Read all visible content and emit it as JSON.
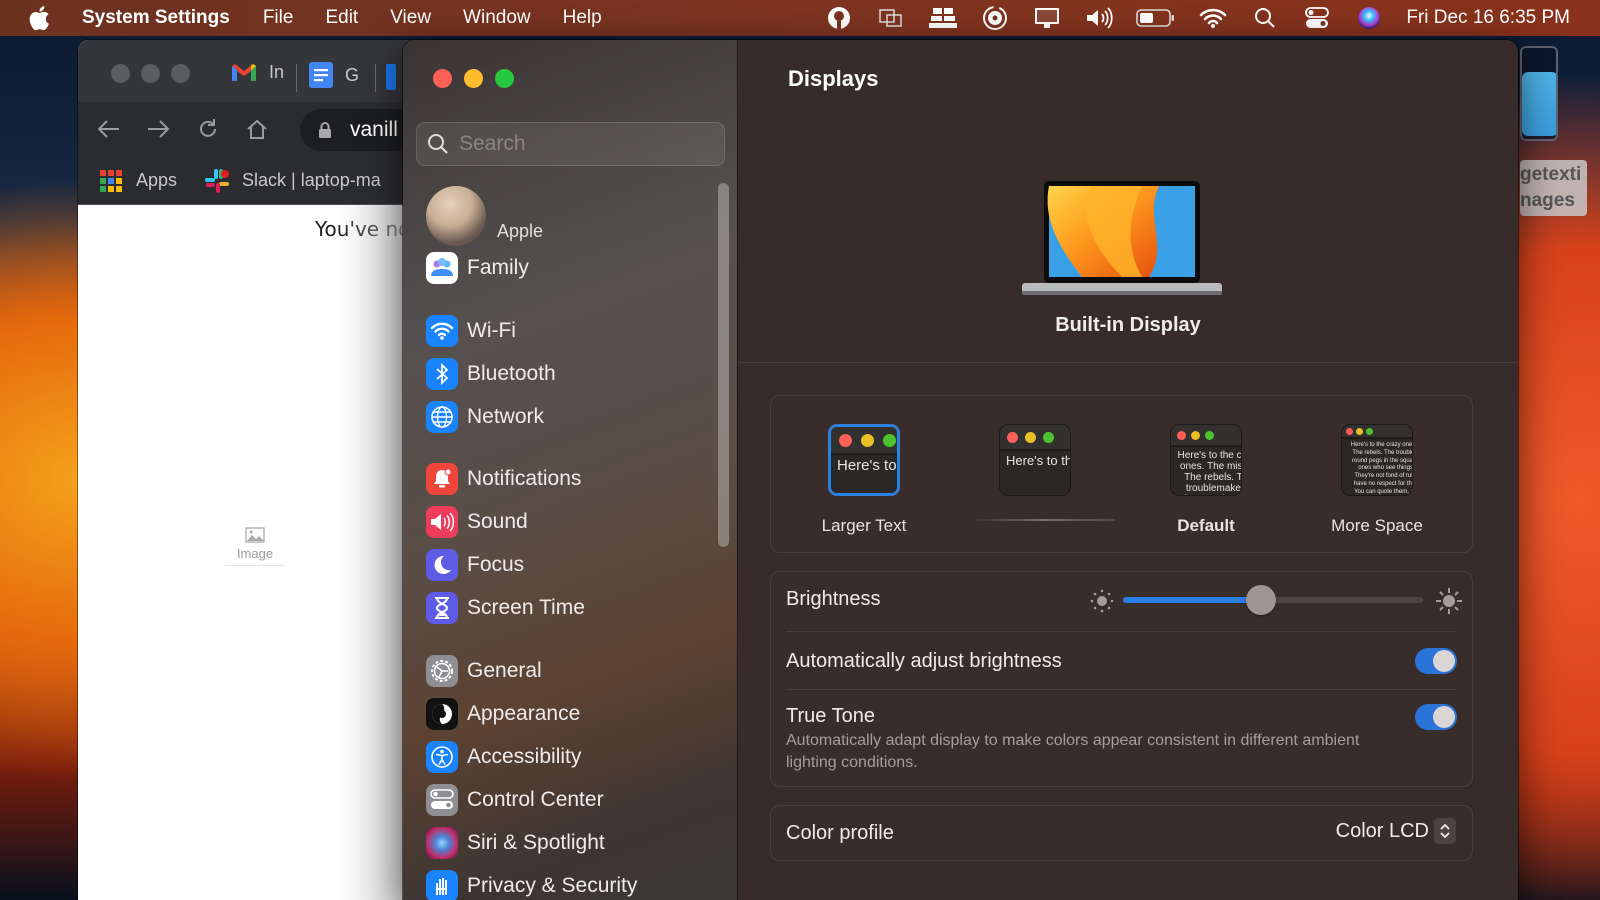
{
  "menubar": {
    "app_name": "System Settings",
    "menus": [
      "File",
      "Edit",
      "View",
      "Window",
      "Help"
    ],
    "status_icons": [
      "vpn-icon",
      "screen-mirroring-icon",
      "dropbox-icon",
      "time-machine-icon",
      "display-icon",
      "volume-icon",
      "battery-icon",
      "wifi-icon",
      "spotlight-search-icon",
      "control-center-icon",
      "siri-icon"
    ],
    "clock": "Fri Dec 16  6:35 PM"
  },
  "browser": {
    "tabs": [
      {
        "icon": "gmail-icon",
        "label": "In"
      },
      {
        "icon": "google-docs-icon",
        "label": "G"
      }
    ],
    "url": "vanill",
    "bookmarks": [
      {
        "icon": "apps-grid-icon",
        "label": "Apps"
      },
      {
        "icon": "slack-icon",
        "label": "Slack | laptop-ma"
      }
    ],
    "page_text": "You've no",
    "image_placeholder_label": "Image"
  },
  "settings": {
    "search": {
      "placeholder": "Search",
      "value": ""
    },
    "account_label": "Apple",
    "sidebar": [
      {
        "id": "family",
        "label": "Family",
        "icon": "family-icon",
        "color": "#ffffff"
      },
      {
        "id": "wifi",
        "label": "Wi-Fi",
        "icon": "wifi-icon",
        "color": "#1a84ff"
      },
      {
        "id": "bluetooth",
        "label": "Bluetooth",
        "icon": "bluetooth-icon",
        "color": "#1a84ff"
      },
      {
        "id": "network",
        "label": "Network",
        "icon": "globe-icon",
        "color": "#1a84ff"
      },
      {
        "id": "notifications",
        "label": "Notifications",
        "icon": "bell-icon",
        "color": "#f0453a"
      },
      {
        "id": "sound",
        "label": "Sound",
        "icon": "speaker-icon",
        "color": "#ee3c5c"
      },
      {
        "id": "focus",
        "label": "Focus",
        "icon": "moon-icon",
        "color": "#5e5ce6"
      },
      {
        "id": "screen-time",
        "label": "Screen Time",
        "icon": "hourglass-icon",
        "color": "#5e5ce6"
      },
      {
        "id": "general",
        "label": "General",
        "icon": "gear-icon",
        "color": "#8e8e93"
      },
      {
        "id": "appearance",
        "label": "Appearance",
        "icon": "appearance-icon",
        "color": "#111111"
      },
      {
        "id": "accessibility",
        "label": "Accessibility",
        "icon": "accessibility-icon",
        "color": "#1a84ff"
      },
      {
        "id": "control-center",
        "label": "Control Center",
        "icon": "toggles-icon",
        "color": "#8e8e93"
      },
      {
        "id": "siri-spotlight",
        "label": "Siri & Spotlight",
        "icon": "siri-icon",
        "color": "#6a2a6a"
      },
      {
        "id": "privacy-security",
        "label": "Privacy & Security",
        "icon": "hand-icon",
        "color": "#1a84ff"
      }
    ],
    "page_title": "Displays",
    "display_name": "Built-in Display",
    "resolution": {
      "selected": "Larger Text",
      "preview_text": "Here's to the crazy ones. The misfits. The rebels. The troublemakers. The round pegs in the square holes. The ones who see things differently. They're not fond of rules. And they have no respect for the status quo. You can quote them, disagree with them, glorify or vilify them. About the only thing you can't do is ignore them. Because they change things.",
      "options": [
        {
          "label": "Larger Text",
          "selected": true,
          "bold": false
        },
        {
          "label": "",
          "selected": false,
          "bold": false
        },
        {
          "label": "Default",
          "selected": false,
          "bold": true
        },
        {
          "label": "More Space",
          "selected": false,
          "bold": false
        }
      ]
    },
    "brightness": {
      "label": "Brightness",
      "value_percent": 46
    },
    "auto_brightness": {
      "label": "Automatically adjust brightness",
      "enabled": true
    },
    "true_tone": {
      "label": "True Tone",
      "description": "Automatically adapt display to make colors appear consistent in different ambient lighting conditions.",
      "enabled": true
    },
    "color_profile": {
      "label": "Color profile",
      "value": "Color LCD"
    }
  },
  "desktop": {
    "file_label_line1": "getexti",
    "file_label_line2": "nages"
  },
  "colors": {
    "accent": "#2a7de2",
    "close": "#fe5f57",
    "minimize": "#febc2e",
    "maximize": "#28c840"
  }
}
